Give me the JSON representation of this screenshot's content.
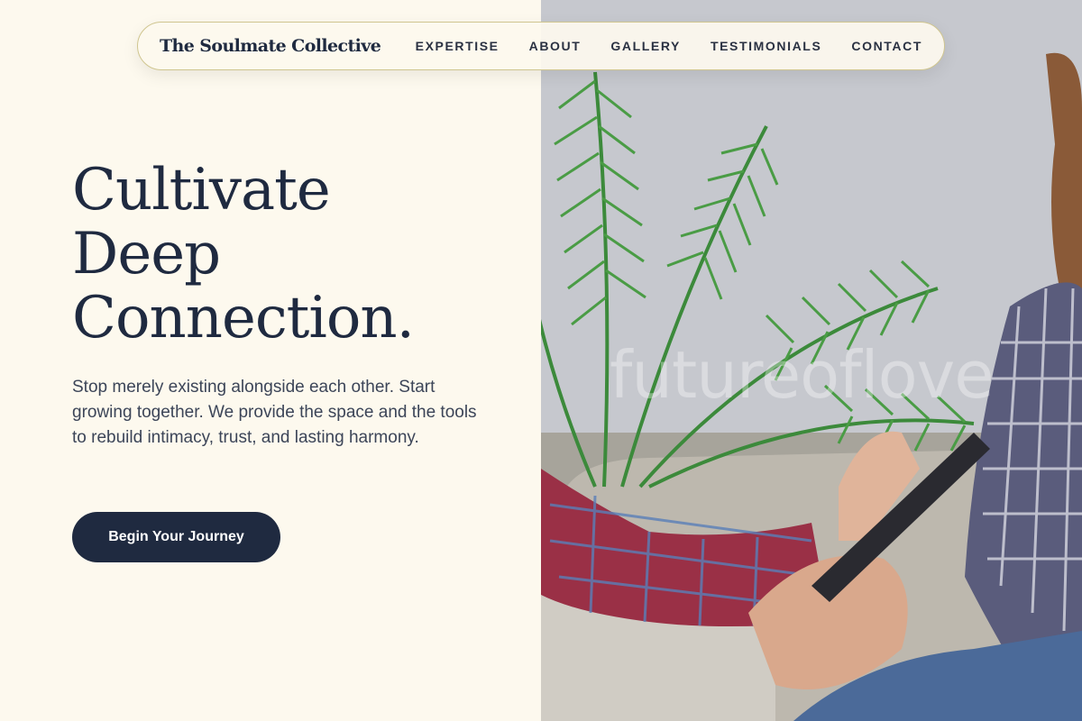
{
  "nav": {
    "brand": "The Soulmate Collective",
    "links": [
      "EXPERTISE",
      "ABOUT",
      "GALLERY",
      "TESTIMONIALS",
      "CONTACT"
    ]
  },
  "hero": {
    "title_lines": [
      "Cultivate",
      "Deep",
      "Connection."
    ],
    "subtitle": "Stop merely existing alongside each other. Start growing together. We provide the space and the tools to rebuild intimacy, trust, and lasting harmony.",
    "cta_label": "Begin Your Journey"
  },
  "photo": {
    "watermark": "futureoflove"
  },
  "colors": {
    "background": "#fdf9ee",
    "navy": "#1f2a40",
    "nav_border": "#cfc58f"
  }
}
